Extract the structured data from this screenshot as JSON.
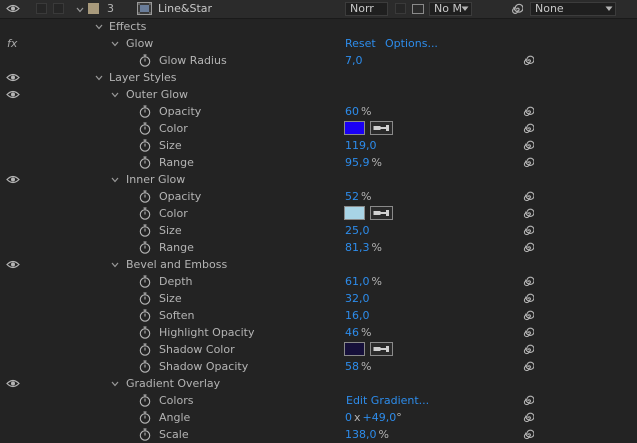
{
  "layer": {
    "number": "3",
    "name": "Line&Star",
    "label_color": "#a89a7c",
    "blend_mode": "Norr",
    "track_matte": "No M",
    "parent": "None"
  },
  "rows": [
    {
      "label": "Effects",
      "depth": 1,
      "twirl": true
    },
    {
      "label": "Glow",
      "depth": 2,
      "twirl": true,
      "fx": true,
      "links": [
        "Reset",
        "Options..."
      ]
    },
    {
      "label": "Glow Radius",
      "depth": 3,
      "stopwatch": true,
      "value": "7,0",
      "spiral": true
    },
    {
      "label": "Layer Styles",
      "depth": 1,
      "twirl": true,
      "eye": true
    },
    {
      "label": "Outer Glow",
      "depth": 2,
      "twirl": true,
      "eye": true
    },
    {
      "label": "Opacity",
      "depth": 3,
      "stopwatch": true,
      "value": "60",
      "unit": "%",
      "spiral": true
    },
    {
      "label": "Color",
      "depth": 3,
      "stopwatch": true,
      "color": "#1a00f5",
      "spiral": true
    },
    {
      "label": "Size",
      "depth": 3,
      "stopwatch": true,
      "value": "119,0",
      "spiral": true
    },
    {
      "label": "Range",
      "depth": 3,
      "stopwatch": true,
      "value": "95,9",
      "unit": "%",
      "spiral": true
    },
    {
      "label": "Inner Glow",
      "depth": 2,
      "twirl": true,
      "eye": true
    },
    {
      "label": "Opacity",
      "depth": 3,
      "stopwatch": true,
      "value": "52",
      "unit": "%",
      "spiral": true
    },
    {
      "label": "Color",
      "depth": 3,
      "stopwatch": true,
      "color": "#a8d4e6",
      "spiral": true
    },
    {
      "label": "Size",
      "depth": 3,
      "stopwatch": true,
      "value": "25,0",
      "spiral": true
    },
    {
      "label": "Range",
      "depth": 3,
      "stopwatch": true,
      "value": "81,3",
      "unit": "%",
      "spiral": true
    },
    {
      "label": "Bevel and Emboss",
      "depth": 2,
      "twirl": true,
      "eye": true
    },
    {
      "label": "Depth",
      "depth": 3,
      "stopwatch": true,
      "value": "61,0",
      "unit": "%",
      "spiral": true
    },
    {
      "label": "Size",
      "depth": 3,
      "stopwatch": true,
      "value": "32,0",
      "spiral": true
    },
    {
      "label": "Soften",
      "depth": 3,
      "stopwatch": true,
      "value": "16,0",
      "spiral": true
    },
    {
      "label": "Highlight Opacity",
      "depth": 3,
      "stopwatch": true,
      "value": "46",
      "unit": "%",
      "spiral": true
    },
    {
      "label": "Shadow Color",
      "depth": 3,
      "stopwatch": true,
      "color": "#16103a",
      "spiral": true
    },
    {
      "label": "Shadow Opacity",
      "depth": 3,
      "stopwatch": true,
      "value": "58",
      "unit": "%",
      "spiral": true
    },
    {
      "label": "Gradient Overlay",
      "depth": 2,
      "twirl": true,
      "eye": true
    },
    {
      "label": "Colors",
      "depth": 3,
      "stopwatch": true,
      "link": "Edit Gradient...",
      "spiral": true
    },
    {
      "label": "Angle",
      "depth": 3,
      "stopwatch": true,
      "value": "0",
      "times": "x",
      "value2": "+49,0",
      "unit2": "°",
      "spiral": true
    },
    {
      "label": "Scale",
      "depth": 3,
      "stopwatch": true,
      "value": "138,0",
      "unit": "%",
      "spiral": true
    }
  ],
  "colors": {
    "background": "#232323",
    "value_blue": "#2d8ceb",
    "text": "#b4b4b4"
  }
}
